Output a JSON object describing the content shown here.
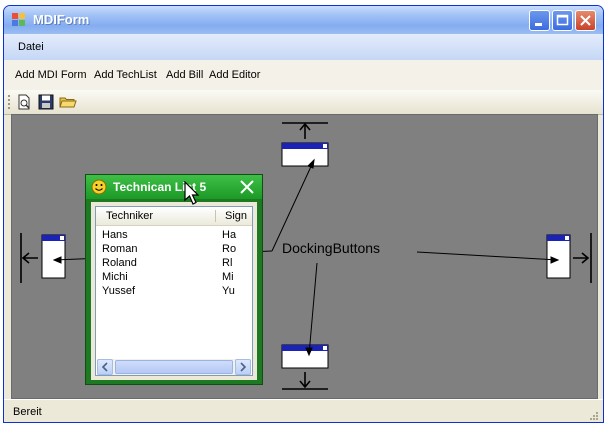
{
  "window": {
    "title": "MDIForm"
  },
  "menu": {
    "items": [
      "Datei"
    ]
  },
  "commands": [
    "Add MDI Form",
    "Add TechList",
    "Add Bill",
    "Add Editor"
  ],
  "toolbar": {
    "icons": [
      "new-document-icon",
      "save-icon",
      "open-folder-icon"
    ]
  },
  "child_window": {
    "title": "Technican List 5",
    "columns": [
      "Techniker",
      "Sign"
    ],
    "rows": [
      {
        "name": "Hans",
        "sign": "Ha"
      },
      {
        "name": "Roman",
        "sign": "Ro"
      },
      {
        "name": "Roland",
        "sign": "Rl"
      },
      {
        "name": "Michi",
        "sign": "Mi"
      },
      {
        "name": "Yussef",
        "sign": "Yu"
      }
    ]
  },
  "annotation": {
    "label": "DockingButtons"
  },
  "statusbar": {
    "text": "Bereit"
  },
  "colors": {
    "mdi_background": "#808080",
    "child_frame": "#1d7a23",
    "title_blue": "#0831d9"
  }
}
